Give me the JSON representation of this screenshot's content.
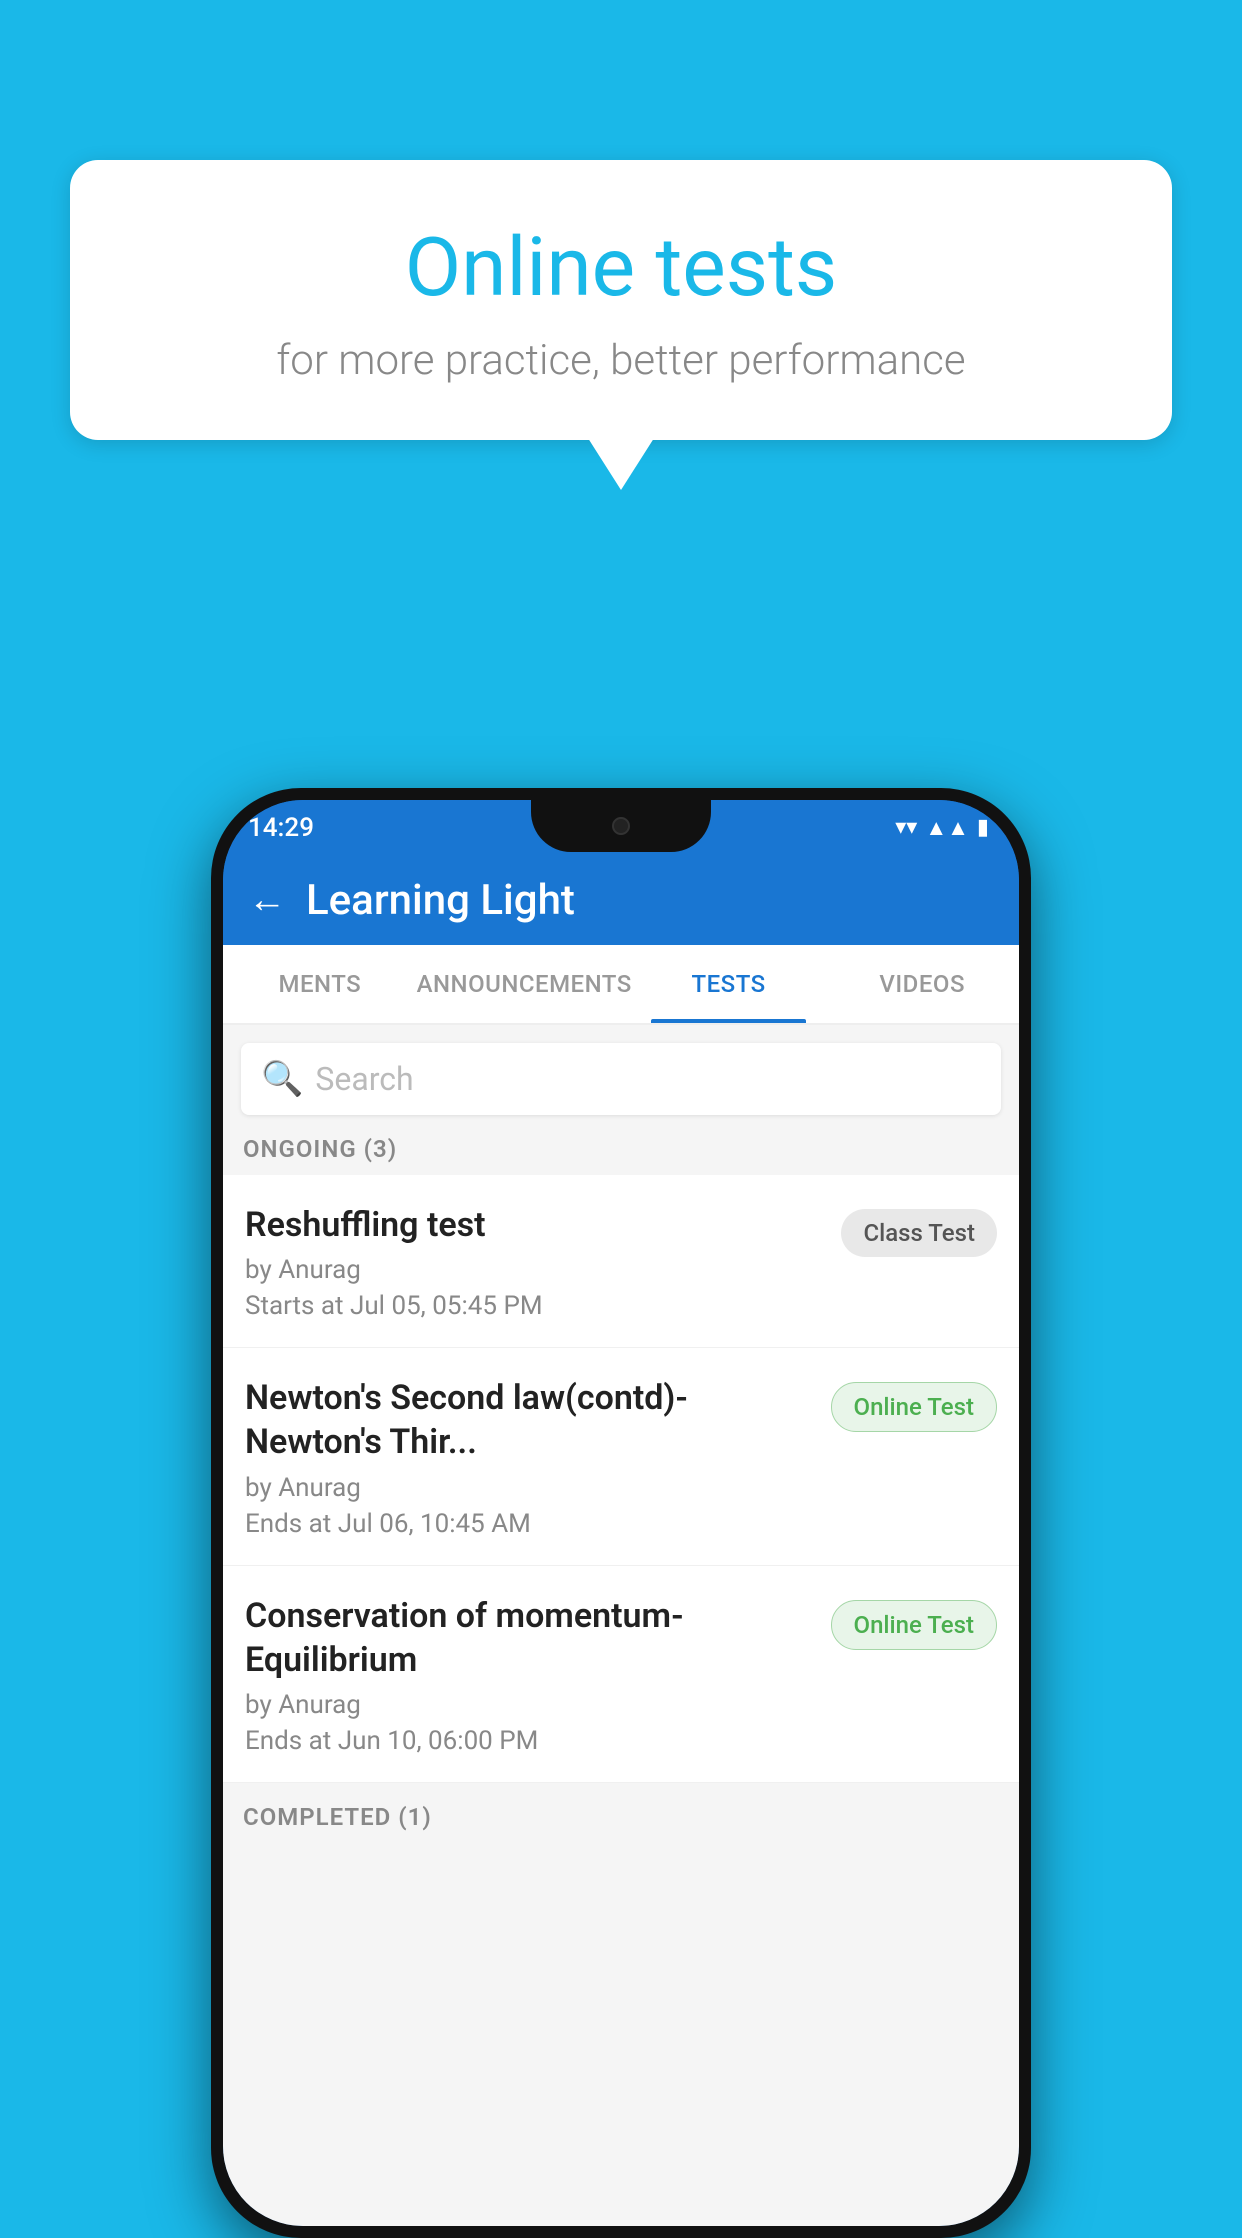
{
  "background_color": "#1ab8e8",
  "speech_bubble": {
    "title": "Online tests",
    "subtitle": "for more practice, better performance"
  },
  "phone": {
    "status_bar": {
      "time": "14:29",
      "icons": [
        "wifi",
        "signal",
        "battery"
      ]
    },
    "app_bar": {
      "title": "Learning Light",
      "back_label": "←"
    },
    "tabs": [
      {
        "label": "MENTS",
        "active": false
      },
      {
        "label": "ANNOUNCEMENTS",
        "active": false
      },
      {
        "label": "TESTS",
        "active": true
      },
      {
        "label": "VIDEOS",
        "active": false
      }
    ],
    "search": {
      "placeholder": "Search"
    },
    "ongoing_section": {
      "label": "ONGOING (3)"
    },
    "tests": [
      {
        "name": "Reshuffling test",
        "author": "by Anurag",
        "time": "Starts at  Jul 05, 05:45 PM",
        "badge": "Class Test",
        "badge_type": "class"
      },
      {
        "name": "Newton's Second law(contd)-Newton's Thir...",
        "author": "by Anurag",
        "time": "Ends at  Jul 06, 10:45 AM",
        "badge": "Online Test",
        "badge_type": "online"
      },
      {
        "name": "Conservation of momentum-Equilibrium",
        "author": "by Anurag",
        "time": "Ends at  Jun 10, 06:00 PM",
        "badge": "Online Test",
        "badge_type": "online"
      }
    ],
    "completed_section": {
      "label": "COMPLETED (1)"
    }
  }
}
